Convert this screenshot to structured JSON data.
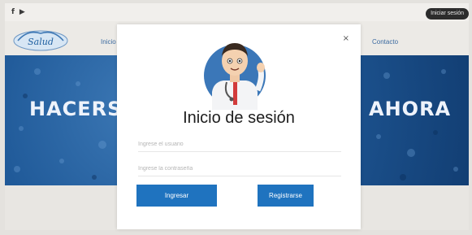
{
  "topbar": {
    "social": [
      {
        "icon": "facebook-icon",
        "glyph": "f"
      },
      {
        "icon": "youtube-icon",
        "glyph": "▶"
      }
    ],
    "account_pill": "Iniciar sesión"
  },
  "navbar": {
    "logo_text": "Salud",
    "left_item": "Inicio",
    "right_item": "Contacto"
  },
  "hero": {
    "left_text": "HACERS",
    "right_text": "AHORA"
  },
  "modal": {
    "close_label": "×",
    "title": "Inicio de sesión",
    "username_placeholder": "Ingrese el usuario",
    "password_placeholder": "Ingrese la contraseña",
    "login_label": "Ingresar",
    "register_label": "Registrarse",
    "avatar_icon": "doctor-avatar-icon"
  },
  "colors": {
    "primary_button": "#1f73bf",
    "hero_blue": "#205a99",
    "nav_link": "#3b6aa0"
  }
}
